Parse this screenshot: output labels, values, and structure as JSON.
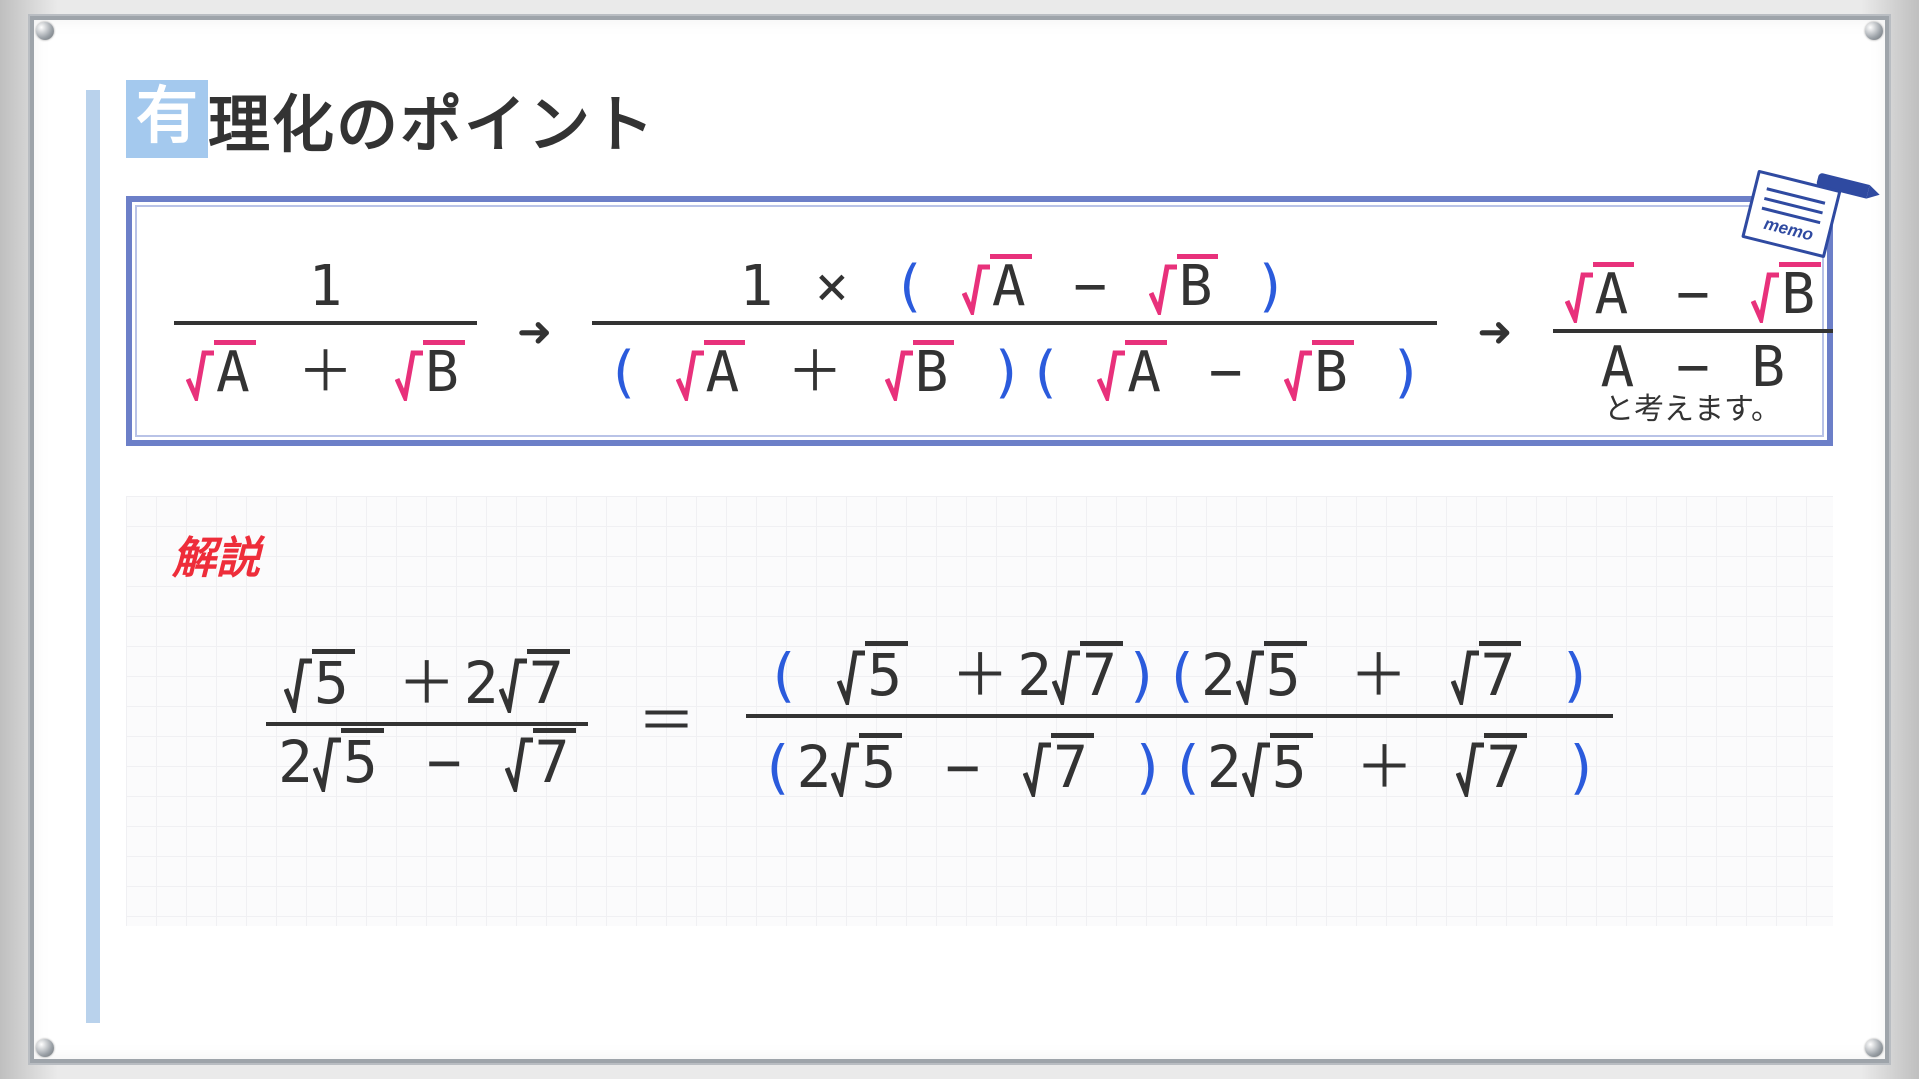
{
  "title": {
    "badge": "有",
    "rest": "理化のポイント"
  },
  "memo": {
    "label": "memo"
  },
  "formula": {
    "step1": {
      "num": "1",
      "denA": "A",
      "denB": "B",
      "op": "＋"
    },
    "step2": {
      "num_left": "1",
      "num_times": "×",
      "num_rA": "A",
      "num_rB": "B",
      "num_op": "−",
      "den_l_rA": "A",
      "den_l_rB": "B",
      "den_l_op": "＋",
      "den_r_rA": "A",
      "den_r_rB": "B",
      "den_r_op": "−"
    },
    "step3": {
      "num_rA": "A",
      "num_rB": "B",
      "num_op": "−",
      "den_A": "A",
      "den_B": "B",
      "den_op": "−"
    },
    "note": "と考えます。",
    "arrow": "➜"
  },
  "explain": {
    "title": "解説",
    "lhs": {
      "num_r5": "5",
      "num_plus": "＋",
      "num_coef2": "2",
      "num_r7": "7",
      "den_coef2": "2",
      "den_r5": "5",
      "den_minus": "−",
      "den_r7": "7"
    },
    "eq": "＝",
    "rhs": {
      "num_g1_r5": "5",
      "num_g1_plus": "＋",
      "num_g1_coef2": "2",
      "num_g1_r7": "7",
      "num_g2_coef2": "2",
      "num_g2_r5": "5",
      "num_g2_plus": "＋",
      "num_g2_r7": "7",
      "den_g1_coef2": "2",
      "den_g1_r5": "5",
      "den_g1_minus": "−",
      "den_g1_r7": "7",
      "den_g2_coef2": "2",
      "den_g2_r5": "5",
      "den_g2_plus": "＋",
      "den_g2_r7": "7"
    }
  },
  "chart_data": {
    "type": "table",
    "title": "Rationalization rule and worked example",
    "rule": {
      "input": "1 / (√A + √B)",
      "multiply_by": "(√A − √B)/(√A − √B)",
      "result": "(√A − √B) / (A − B)"
    },
    "example": {
      "expression": "(√5 + 2√7) / (2√5 − √7)",
      "rewritten": "((√5 + 2√7)(2√5 + √7)) / ((2√5 − √7)(2√5 + √7))"
    }
  }
}
